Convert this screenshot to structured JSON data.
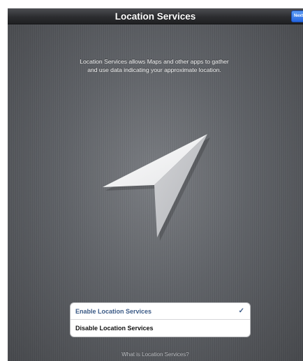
{
  "navbar": {
    "title": "Location Services",
    "next_label": "Next"
  },
  "intro": {
    "description": "Location Services allows Maps and other apps to gather and use data indicating your approximate location."
  },
  "hero": {
    "icon": "location-arrow-icon"
  },
  "options": {
    "items": [
      {
        "label": "Enable Location Services",
        "selected": true
      },
      {
        "label": "Disable Location Services",
        "selected": false
      }
    ],
    "check_glyph": "✓"
  },
  "footer": {
    "help_link": "What is Location Services?"
  },
  "colors": {
    "navbar": "#2c2d30",
    "next_button": "#2566e0",
    "selected_text": "#3b5a86",
    "background": "#5f6267"
  }
}
